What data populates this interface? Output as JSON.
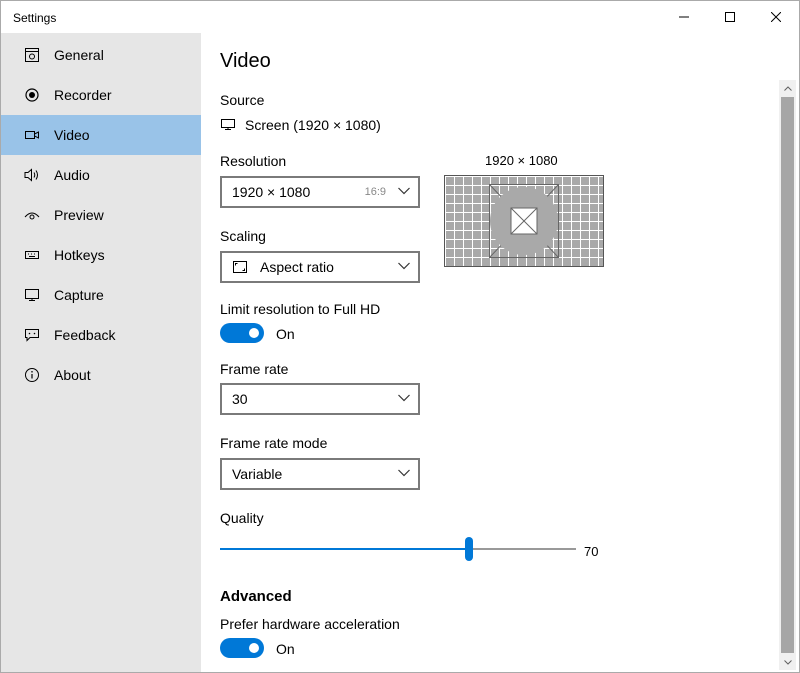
{
  "window": {
    "title": "Settings"
  },
  "sidebar": {
    "items": [
      {
        "label": "General",
        "icon": "general-icon",
        "active": false
      },
      {
        "label": "Recorder",
        "icon": "record-icon",
        "active": false
      },
      {
        "label": "Video",
        "icon": "video-icon",
        "active": true
      },
      {
        "label": "Audio",
        "icon": "speaker-icon",
        "active": false
      },
      {
        "label": "Preview",
        "icon": "eye-icon",
        "active": false
      },
      {
        "label": "Hotkeys",
        "icon": "keyboard-icon",
        "active": false
      },
      {
        "label": "Capture",
        "icon": "monitor-icon",
        "active": false
      },
      {
        "label": "Feedback",
        "icon": "feedback-icon",
        "active": false
      },
      {
        "label": "About",
        "icon": "info-icon",
        "active": false
      }
    ],
    "active_color": "#99c3e8"
  },
  "main": {
    "heading": "Video",
    "source": {
      "label": "Source",
      "value": "Screen (1920 × 1080)"
    },
    "resolution": {
      "label": "Resolution",
      "value": "1920 × 1080",
      "aspect": "16:9"
    },
    "preview": {
      "caption": "1920 × 1080"
    },
    "scaling": {
      "label": "Scaling",
      "value": "Aspect ratio"
    },
    "limit_resolution": {
      "label": "Limit resolution to Full HD",
      "state": "On"
    },
    "frame_rate": {
      "label": "Frame rate",
      "value": "30"
    },
    "frame_rate_mode": {
      "label": "Frame rate mode",
      "value": "Variable"
    },
    "quality": {
      "label": "Quality",
      "value": "70",
      "level": 0.7
    },
    "advanced": {
      "heading": "Advanced"
    },
    "hardware_acceleration": {
      "label": "Prefer hardware acceleration",
      "state": "On"
    }
  },
  "colors": {
    "accent": "#0078d7",
    "sidebar_bg": "#e6e6e6"
  }
}
